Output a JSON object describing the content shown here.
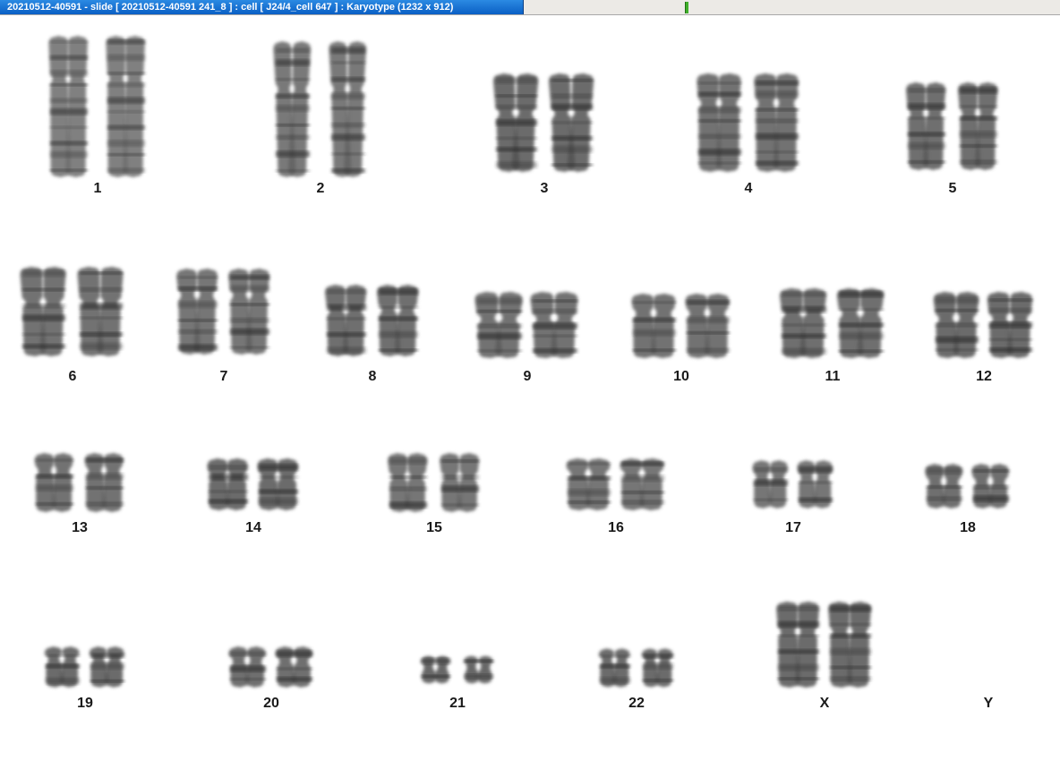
{
  "window": {
    "title": "20210512-40591 - slide [ 20210512-40591 241_8 ] : cell [ J24/4_cell 647 ] : Karyotype  (1232 x 912)"
  },
  "karyotype": {
    "chromosomes": [
      {
        "label": "1"
      },
      {
        "label": "2"
      },
      {
        "label": "3"
      },
      {
        "label": "4"
      },
      {
        "label": "5"
      },
      {
        "label": "6"
      },
      {
        "label": "7"
      },
      {
        "label": "8"
      },
      {
        "label": "9"
      },
      {
        "label": "10"
      },
      {
        "label": "11"
      },
      {
        "label": "12"
      },
      {
        "label": "13"
      },
      {
        "label": "14"
      },
      {
        "label": "15"
      },
      {
        "label": "16"
      },
      {
        "label": "17"
      },
      {
        "label": "18"
      },
      {
        "label": "19"
      },
      {
        "label": "20"
      },
      {
        "label": "21"
      },
      {
        "label": "22"
      },
      {
        "label": "X"
      },
      {
        "label": "Y"
      }
    ]
  }
}
